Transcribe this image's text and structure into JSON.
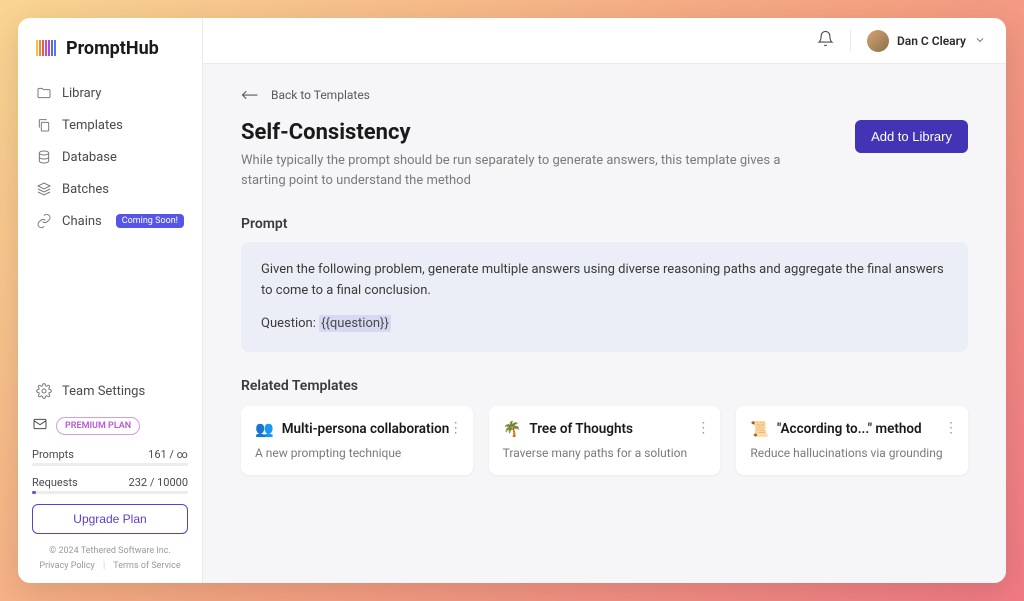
{
  "brand": "PromptHub",
  "nav": {
    "library": "Library",
    "templates": "Templates",
    "database": "Database",
    "batches": "Batches",
    "chains": "Chains",
    "chains_badge": "Coming Soon!"
  },
  "team_settings": "Team Settings",
  "plan": {
    "badge": "PREMIUM PLAN",
    "prompts_label": "Prompts",
    "prompts_value": "161 / ∞",
    "requests_label": "Requests",
    "requests_value": "232 / 10000",
    "requests_pct": 2.3,
    "upgrade": "Upgrade Plan"
  },
  "footer": {
    "copyright": "© 2024 Tethered Software Inc.",
    "privacy": "Privacy Policy",
    "terms": "Terms of Service"
  },
  "user": {
    "name": "Dan C Cleary"
  },
  "back_label": "Back to Templates",
  "page": {
    "title": "Self-Consistency",
    "desc": "While typically the prompt should be run separately to generate answers, this template gives a starting point to understand the method",
    "add_btn": "Add to Library"
  },
  "prompt": {
    "label": "Prompt",
    "body": "Given the following problem, generate multiple answers using diverse reasoning paths and aggregate the final answers to come to a final conclusion.",
    "question_prefix": "Question: ",
    "question_var": "{{question}}"
  },
  "related": {
    "label": "Related Templates",
    "cards": [
      {
        "emoji": "👥",
        "title": "Multi-persona collaboration",
        "desc": "A new prompting technique"
      },
      {
        "emoji": "🌴",
        "title": "Tree of Thoughts",
        "desc": "Traverse many paths for a solution"
      },
      {
        "emoji": "📜",
        "title": "\"According to...\" method",
        "desc": "Reduce hallucinations via grounding"
      }
    ]
  }
}
